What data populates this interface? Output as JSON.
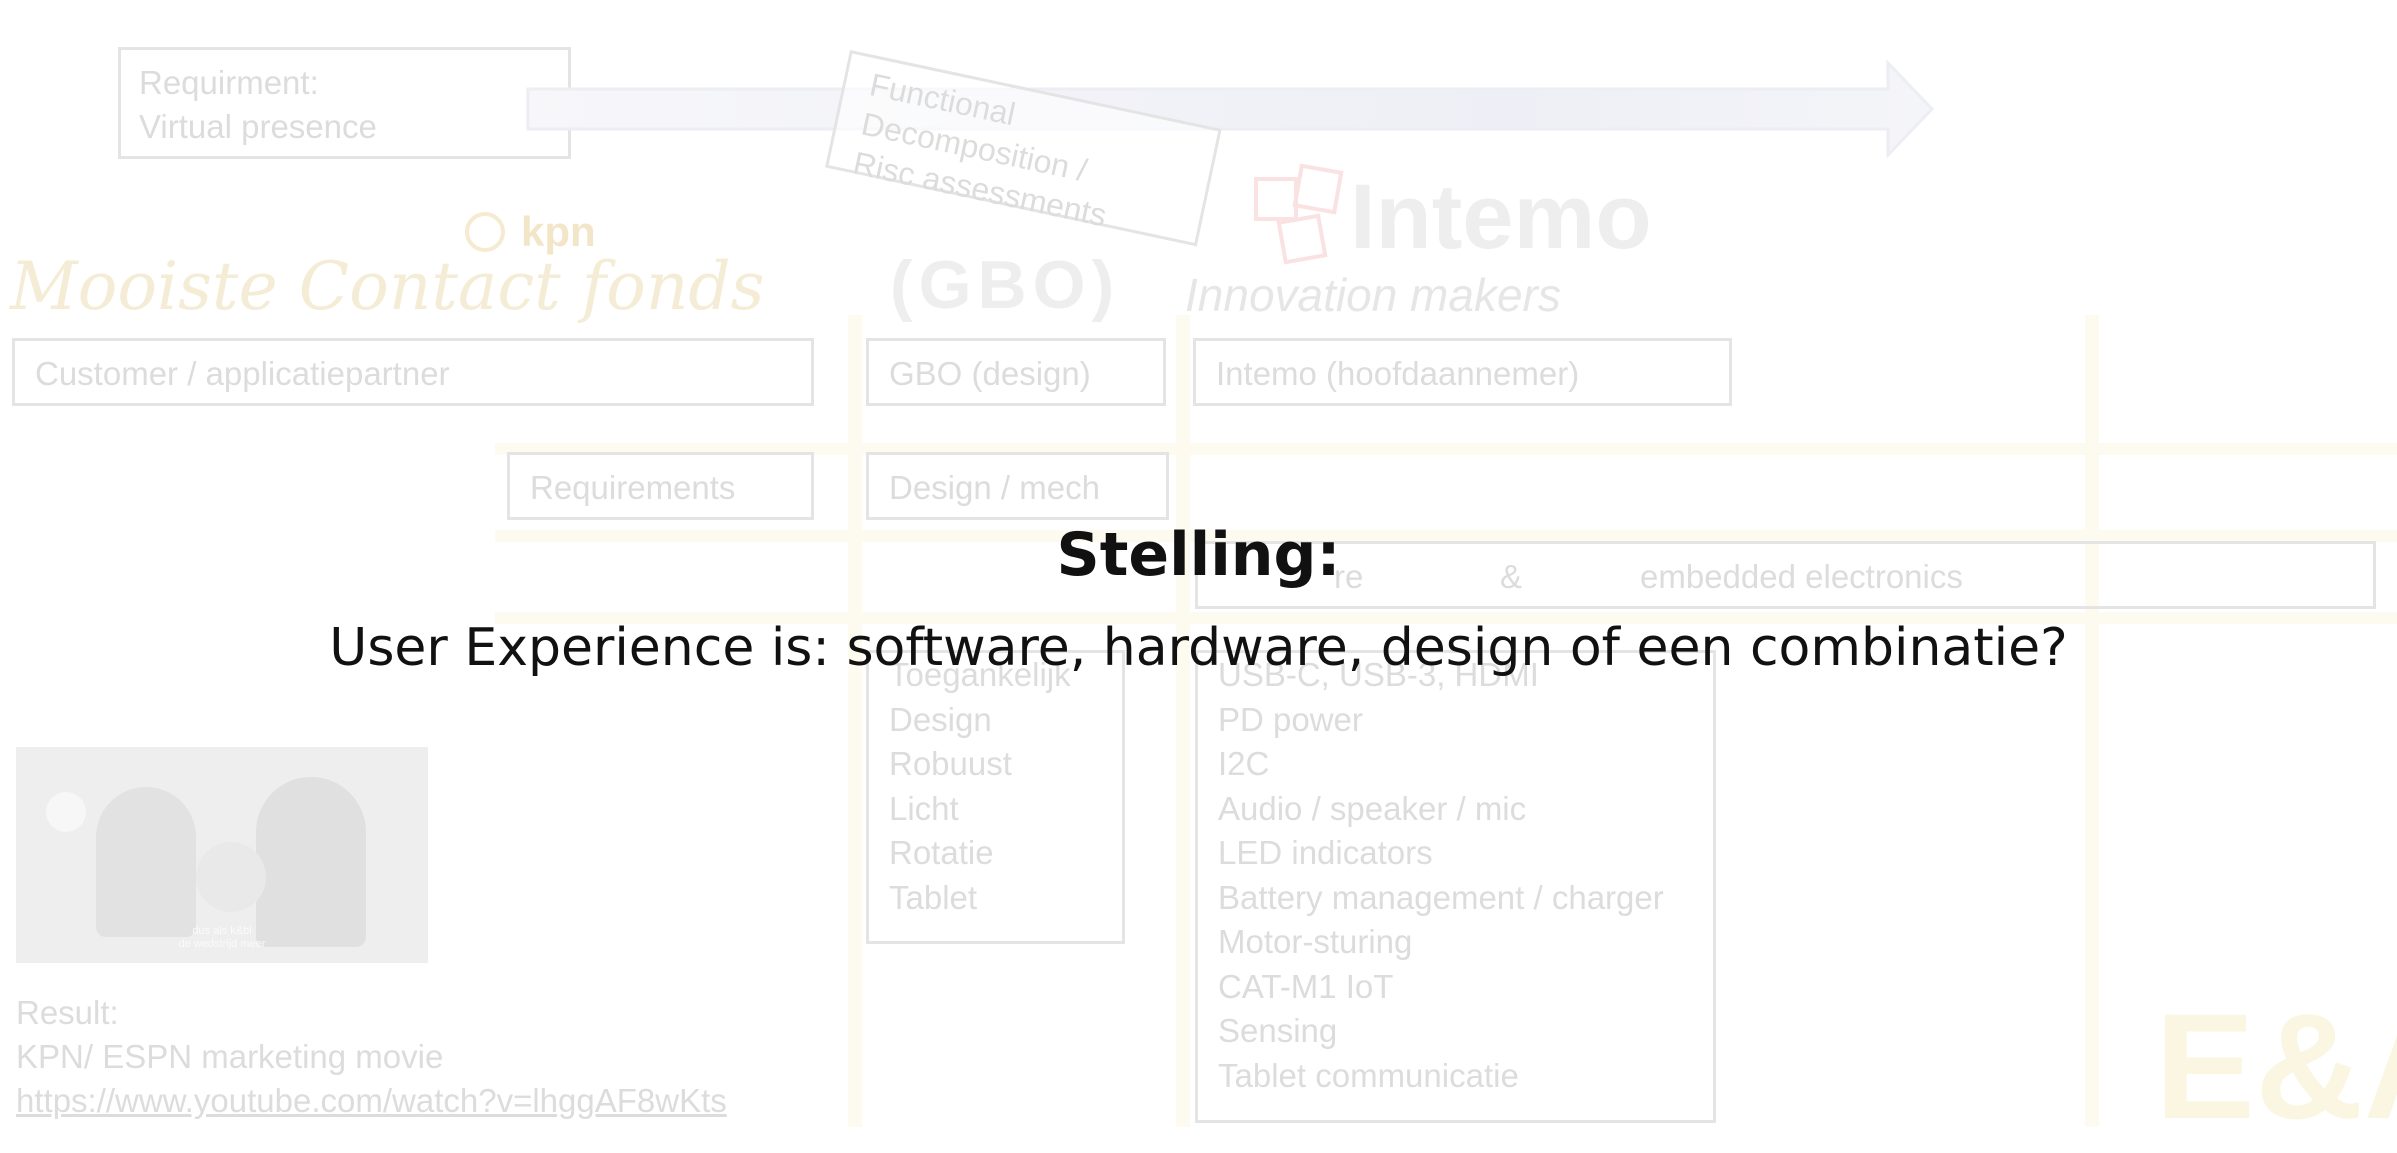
{
  "slide": {
    "title": "Stelling:",
    "subtitle": "User Experience is: software, hardware, design of een combinatie?"
  },
  "background": {
    "requirement_line1": "Requirment:",
    "requirement_line2": "Virtual presence",
    "functional_line1": "Functional",
    "functional_line2": "Decomposition /",
    "functional_line3": "Risc assessments",
    "logo_kpn": "kpn",
    "logo_mcf": "Mooiste Contact fonds",
    "logo_gbo": "(GBO)",
    "logo_intemo": "Intemo",
    "logo_intemo_tag": "Innovation makers",
    "col_customer": "Customer / applicatiepartner",
    "col_gbo": "GBO (design)",
    "col_intemo": "Intemo (hoofdaannemer)",
    "row_requirements": "Requirements",
    "row_design": "Design / mech",
    "row_software_a": "re",
    "row_software_amp": "&",
    "row_software_b": "embedded electronics",
    "design_items": [
      "Toegankelijk",
      "Design",
      "Robuust",
      "Licht",
      "Rotatie",
      "Tablet"
    ],
    "electronics_items": [
      "USB-C, USB-3, HDMI",
      "PD power",
      "I2C",
      "Audio / speaker / mic",
      "LED indicators",
      "Battery management / charger",
      "Motor-sturing",
      "CAT-M1 IoT",
      "Sensing",
      "Tablet communicatie"
    ],
    "video_caption_1": "dus als k&bl",
    "video_caption_2": "de wedstrijd meer",
    "result_label": "Result:",
    "result_text": "KPN/ ESPN marketing movie",
    "result_link": "https://www.youtube.com/watch?v=lhggAF8wKts",
    "logo_ea": "E&A"
  },
  "colors": {
    "arrow": "#eeeff6",
    "grid": "#fdfbef",
    "faint": "#dcdcdc",
    "text": "#111111"
  }
}
